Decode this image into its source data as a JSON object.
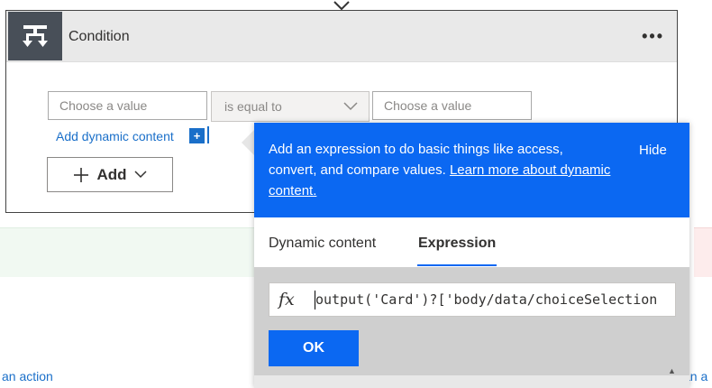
{
  "card": {
    "title": "Condition",
    "more": "•••",
    "left_value_placeholder": "Choose a value",
    "operator": "is equal to",
    "right_value_placeholder": "Choose a value",
    "add_dynamic_label": "Add dynamic content",
    "add_dynamic_plus": "+",
    "add_label": "Add"
  },
  "popup": {
    "info_text": "Add an expression to do basic things like access, convert, and compare values.",
    "learn_more": "Learn more about dynamic content.",
    "hide_label": "Hide",
    "tabs": [
      {
        "label": "Dynamic content",
        "active": false
      },
      {
        "label": "Expression",
        "active": true
      }
    ],
    "fx_symbol": "fx",
    "expression": "output('Card')?['body/data/choiceSelection",
    "ok_label": "OK"
  },
  "background": {
    "left_link": "an action",
    "right_link": "an a"
  },
  "colors": {
    "accent": "#0b68f2",
    "link": "#1a6fc9",
    "header_bg": "#e9e9e9",
    "icon_bg": "#484f58"
  }
}
